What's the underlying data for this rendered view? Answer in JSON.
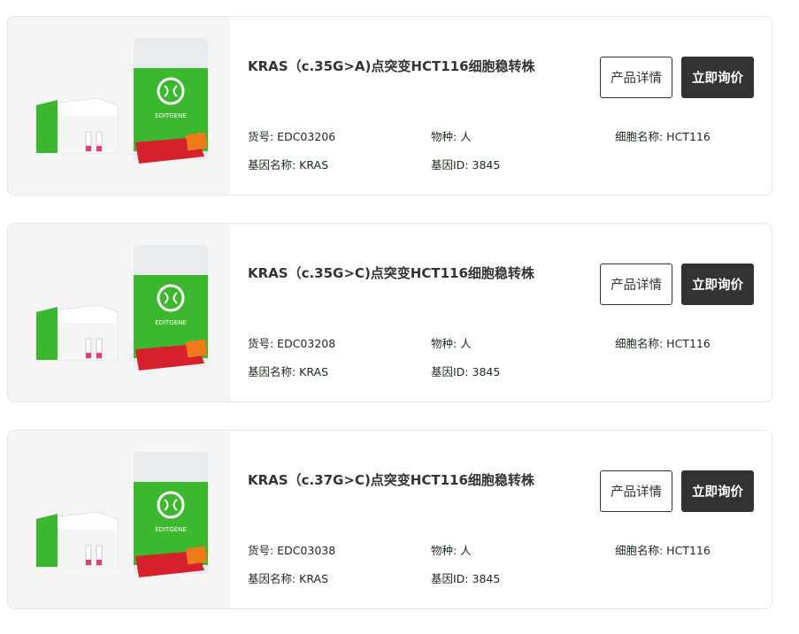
{
  "products": [
    {
      "title": "KRAS（c.35G>A)点突变HCT116细胞稳转株",
      "sku": "货号: EDC03206",
      "species": "物种: 人",
      "cell_name": "细胞名称: HCT116",
      "gene_name": "基因名称: KRAS",
      "gene_id": "基因ID: 3845",
      "detail_label": "产品详情",
      "inquire_label": "立即询价",
      "brand": "EDITGENE"
    },
    {
      "title": "KRAS（c.35G>C)点突变HCT116细胞稳转株",
      "sku": "货号: EDC03208",
      "species": "物种: 人",
      "cell_name": "细胞名称: HCT116",
      "gene_name": "基因名称: KRAS",
      "gene_id": "基因ID: 3845",
      "detail_label": "产品详情",
      "inquire_label": "立即询价",
      "brand": "EDITGENE"
    },
    {
      "title": "KRAS（c.37G>C)点突变HCT116细胞稳转株",
      "sku": "货号: EDC03038",
      "species": "物种: 人",
      "cell_name": "细胞名称: HCT116",
      "gene_name": "基因名称: KRAS",
      "gene_id": "基因ID: 3845",
      "detail_label": "产品详情",
      "inquire_label": "立即询价",
      "brand": "EDITGENE"
    }
  ],
  "colors": {
    "brand_green": "#3cb82e",
    "button_dark": "#333333",
    "card_border": "#e6e6e6",
    "thumb_bg": "#f5f5f5"
  }
}
